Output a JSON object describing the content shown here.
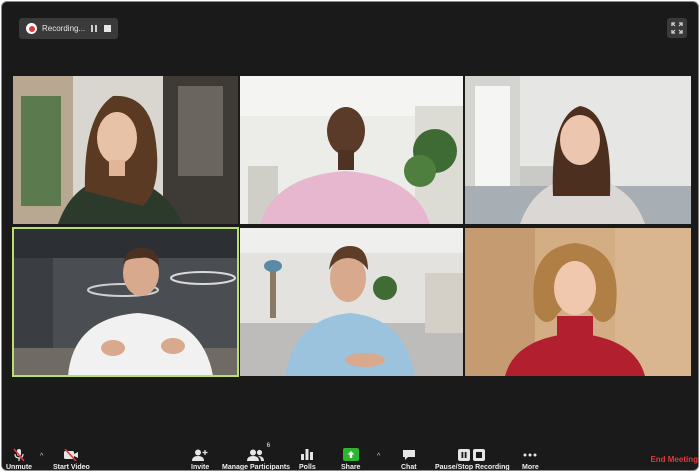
{
  "recording": {
    "label": "Recording..."
  },
  "toolbar": {
    "unmute": "Unmute",
    "start_video": "Start Video",
    "invite": "Invite",
    "manage_participants": "Manage Participants",
    "participant_count": "6",
    "polls": "Polls",
    "share": "Share",
    "chat": "Chat",
    "pause_stop_recording": "Pause/Stop Recording",
    "more": "More",
    "end_meeting": "End Meeting"
  },
  "colors": {
    "recording": "#e5383b",
    "active_speaker": "#b9e06f",
    "share": "#2db52d",
    "end_meeting": "#e5383b"
  },
  "icons": {
    "unmute": "muted-microphone-icon",
    "start_video": "video-off-icon",
    "invite": "add-user-icon",
    "manage_participants": "participants-icon",
    "polls": "bar-chart-icon",
    "share": "share-arrow-icon",
    "chat": "chat-bubble-icon",
    "pause_stop_recording": "pause-stop-icon",
    "more": "more-dots-icon",
    "fullscreen": "fullscreen-icon"
  }
}
